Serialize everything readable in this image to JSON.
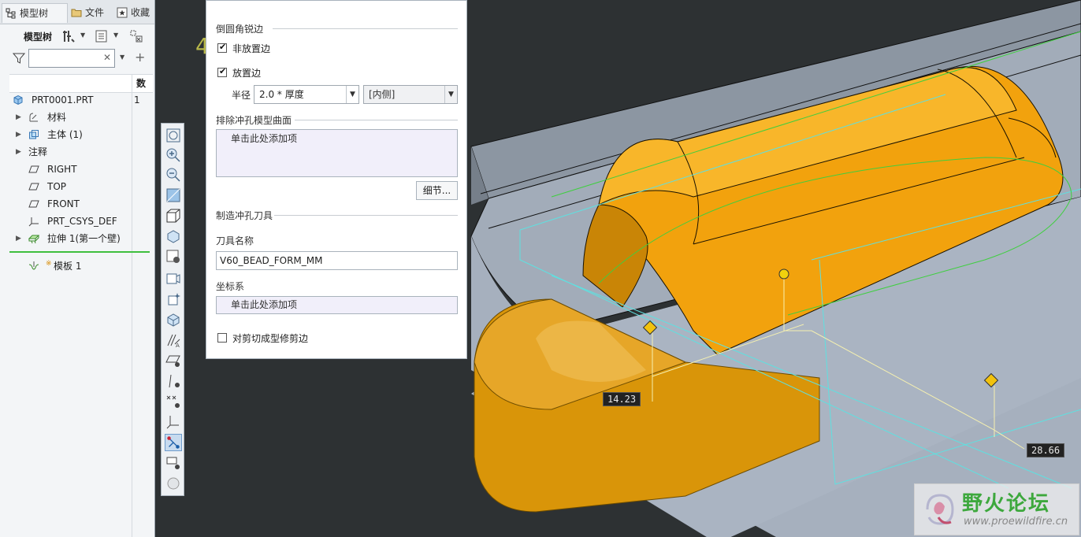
{
  "tabs": [
    {
      "label": "模型树",
      "icon": "model-tree-icon"
    },
    {
      "label": "文件",
      "icon": "folder-icon"
    },
    {
      "label": "收藏",
      "icon": "favorites-icon"
    }
  ],
  "tree_toolbar": {
    "label": "模型树",
    "icons": [
      "tree-settings-icon",
      "show-icon",
      "filter-settings-icon"
    ]
  },
  "search": {
    "placeholder": "",
    "value": ""
  },
  "tree_columns": {
    "col1": "",
    "col2": "数量"
  },
  "tree_items": [
    {
      "label": "PRT0001.PRT",
      "num": "1",
      "icon": "part-icon",
      "expandable": false
    },
    {
      "label": "材料",
      "num": "",
      "icon": "material-icon",
      "expandable": true
    },
    {
      "label": "主体 (1)",
      "num": "",
      "icon": "body-icon",
      "expandable": true
    },
    {
      "label": "注释",
      "num": "",
      "icon": "",
      "expandable": true
    },
    {
      "label": "RIGHT",
      "num": "",
      "icon": "datum-plane-icon",
      "expandable": false
    },
    {
      "label": "TOP",
      "num": "",
      "icon": "datum-plane-icon",
      "expandable": false
    },
    {
      "label": "FRONT",
      "num": "",
      "icon": "datum-plane-icon",
      "expandable": false
    },
    {
      "label": "PRT_CSYS_DEF",
      "num": "",
      "icon": "csys-icon",
      "expandable": false
    },
    {
      "label": "拉伸 1(第一个壁)",
      "num": "",
      "icon": "extrude-icon",
      "expandable": true
    },
    {
      "label": "模板 1",
      "num": "",
      "icon": "form-icon",
      "expandable": false,
      "prefix": "※"
    }
  ],
  "dialog": {
    "section_round": "倒圆角锐边",
    "non_placement_edge": "非放置边",
    "placement_edge": "放置边",
    "non_placement_checked": true,
    "placement_checked": true,
    "radius_label": "半径",
    "radius_value": "2.0 * 厚度",
    "side_value": "[内侧]",
    "section_exclude": "排除冲孔模型曲面",
    "exclude_placeholder": "单击此处添加项",
    "details_button": "细节...",
    "section_tool": "制造冲孔刀具",
    "tool_name_label": "刀具名称",
    "tool_name_value": "V60_BEAD_FORM_MM",
    "csys_label": "坐标系",
    "csys_placeholder": "单击此处添加项",
    "trim_label": "对剪切成型修剪边",
    "trim_checked": false
  },
  "dimensions": {
    "d1": "14.23",
    "d2": "28.66"
  },
  "watermark": {
    "title": "野火论坛",
    "url": "www.proewildfire.cn"
  },
  "colors": {
    "form_orange": "#f2a20d",
    "sheet_gray": "#a4aebc",
    "viewport_bg": "#2d3133"
  }
}
